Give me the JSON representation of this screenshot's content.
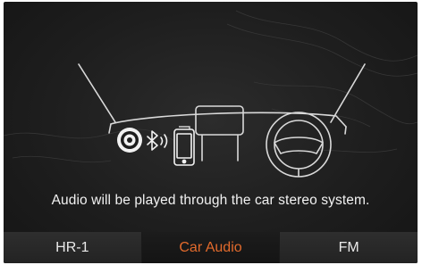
{
  "message": "Audio will be played through the car stereo system.",
  "icons": {
    "speaker": "speaker-icon",
    "bluetooth": "bluetooth-icon",
    "phone": "smartphone-icon",
    "display": "head-unit-display-icon",
    "steering": "steering-wheel-icon"
  },
  "tabs": [
    {
      "label": "HR-1",
      "active": false
    },
    {
      "label": "Car Audio",
      "active": true
    },
    {
      "label": "FM",
      "active": false
    }
  ],
  "colors": {
    "accent": "#e26a2c",
    "background": "#1e1e1e",
    "line_art": "#d9d9d9"
  }
}
